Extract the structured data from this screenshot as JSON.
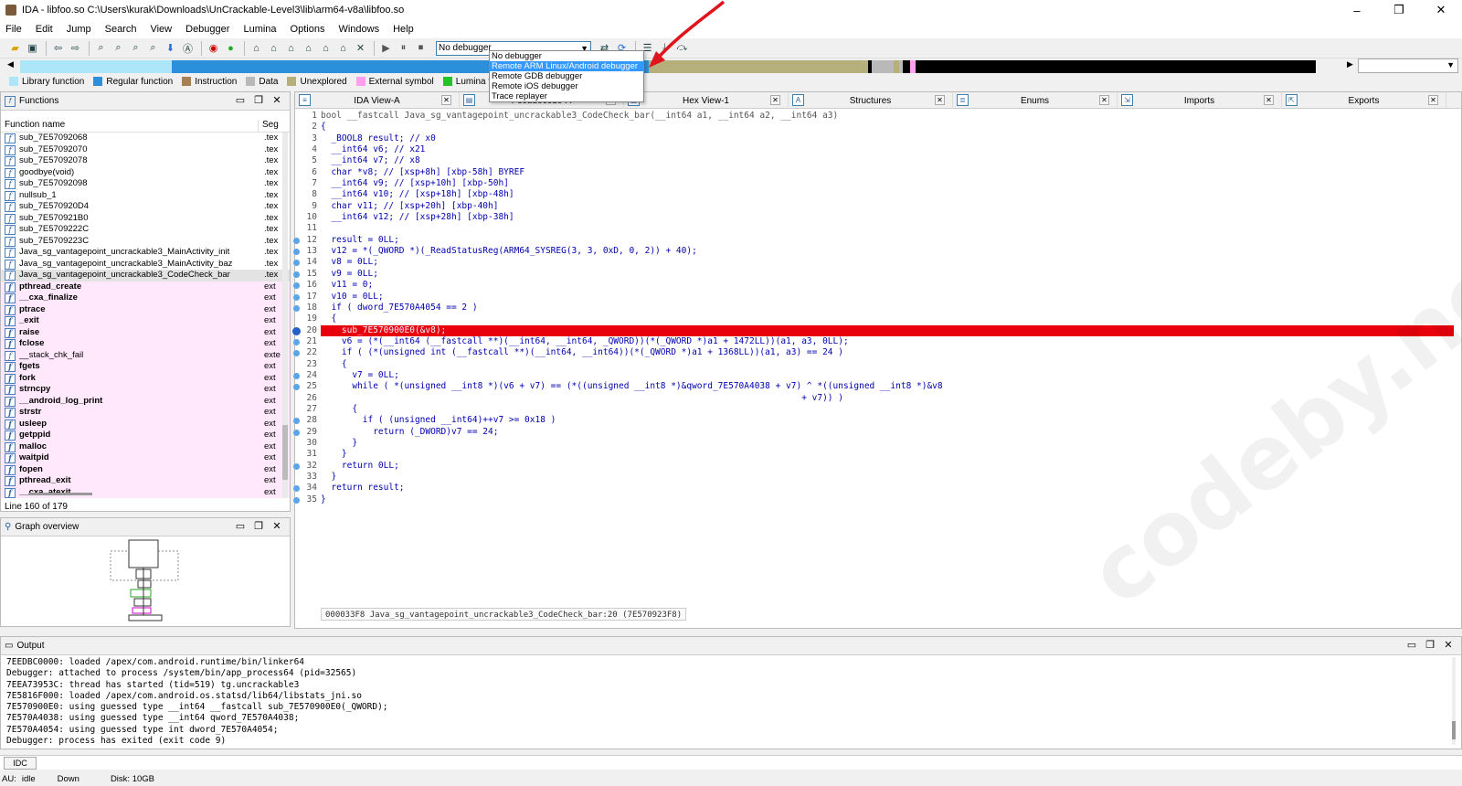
{
  "window": {
    "title": "IDA - libfoo.so C:\\Users\\kurak\\Downloads\\UnCrackable-Level3\\lib\\arm64-v8a\\libfoo.so",
    "controls": [
      "–",
      "❐",
      "✕"
    ]
  },
  "menu": [
    "File",
    "Edit",
    "Jump",
    "Search",
    "View",
    "Debugger",
    "Lumina",
    "Options",
    "Windows",
    "Help"
  ],
  "debugger": {
    "selected": "No debugger",
    "options": [
      "No debugger",
      "Remote ARM Linux/Android debugger",
      "Remote GDB debugger",
      "Remote iOS debugger",
      "Trace replayer"
    ],
    "highlighted_index": 1
  },
  "legend": [
    {
      "label": "Library function",
      "color": "#aee6f9"
    },
    {
      "label": "Regular function",
      "color": "#2b8fdc"
    },
    {
      "label": "Instruction",
      "color": "#a87e54"
    },
    {
      "label": "Data",
      "color": "#b9b9b9"
    },
    {
      "label": "Unexplored",
      "color": "#b5b07b"
    },
    {
      "label": "External symbol",
      "color": "#ff9fee"
    },
    {
      "label": "Lumina function",
      "color": "#22c22b"
    }
  ],
  "functions_panel": {
    "title": "Functions",
    "col_name": "Function name",
    "col_seg": "Seg",
    "rows": [
      {
        "name": "sub_7E57092068",
        "seg": ".tex",
        "kind": "normal"
      },
      {
        "name": "sub_7E57092070",
        "seg": ".tex",
        "kind": "normal"
      },
      {
        "name": "sub_7E57092078",
        "seg": ".tex",
        "kind": "normal"
      },
      {
        "name": "goodbye(void)",
        "seg": ".tex",
        "kind": "normal"
      },
      {
        "name": "sub_7E57092098",
        "seg": ".tex",
        "kind": "normal"
      },
      {
        "name": "nullsub_1",
        "seg": ".tex",
        "kind": "normal"
      },
      {
        "name": "sub_7E570920D4",
        "seg": ".tex",
        "kind": "normal"
      },
      {
        "name": "sub_7E570921B0",
        "seg": ".tex",
        "kind": "normal"
      },
      {
        "name": "sub_7E5709222C",
        "seg": ".tex",
        "kind": "normal"
      },
      {
        "name": "sub_7E5709223C",
        "seg": ".tex",
        "kind": "normal"
      },
      {
        "name": "Java_sg_vantagepoint_uncrackable3_MainActivity_init",
        "seg": ".tex",
        "kind": "normal"
      },
      {
        "name": "Java_sg_vantagepoint_uncrackable3_MainActivity_baz",
        "seg": ".tex",
        "kind": "normal"
      },
      {
        "name": "Java_sg_vantagepoint_uncrackable3_CodeCheck_bar",
        "seg": ".tex",
        "kind": "selected"
      },
      {
        "name": "pthread_create",
        "seg": "ext",
        "kind": "import"
      },
      {
        "name": "__cxa_finalize",
        "seg": "ext",
        "kind": "import"
      },
      {
        "name": "ptrace",
        "seg": "ext",
        "kind": "import"
      },
      {
        "name": "_exit",
        "seg": "ext",
        "kind": "import"
      },
      {
        "name": "raise",
        "seg": "ext",
        "kind": "import"
      },
      {
        "name": "fclose",
        "seg": "ext",
        "kind": "import"
      },
      {
        "name": "__stack_chk_fail",
        "seg": "exte",
        "kind": "import-light"
      },
      {
        "name": "fgets",
        "seg": "ext",
        "kind": "import"
      },
      {
        "name": "fork",
        "seg": "ext",
        "kind": "import"
      },
      {
        "name": "strncpy",
        "seg": "ext",
        "kind": "import"
      },
      {
        "name": "__android_log_print",
        "seg": "ext",
        "kind": "import"
      },
      {
        "name": "strstr",
        "seg": "ext",
        "kind": "import"
      },
      {
        "name": "usleep",
        "seg": "ext",
        "kind": "import"
      },
      {
        "name": "getppid",
        "seg": "ext",
        "kind": "import"
      },
      {
        "name": "malloc",
        "seg": "ext",
        "kind": "import"
      },
      {
        "name": "waitpid",
        "seg": "ext",
        "kind": "import"
      },
      {
        "name": "fopen",
        "seg": "ext",
        "kind": "import"
      },
      {
        "name": "pthread_exit",
        "seg": "ext",
        "kind": "import"
      },
      {
        "name": "__cxa_atexit",
        "seg": "ext",
        "kind": "import"
      }
    ],
    "status": "Line 160 of 179"
  },
  "graph_panel": {
    "title": "Graph overview"
  },
  "tabs": [
    {
      "label": "IDA View-A",
      "icon": "≡"
    },
    {
      "label": "Pseudocode-A",
      "icon": "▤"
    },
    {
      "label": "Hex View-1",
      "icon": "▦"
    },
    {
      "label": "Structures",
      "icon": "A"
    },
    {
      "label": "Enums",
      "icon": "≣"
    },
    {
      "label": "Imports",
      "icon": "⇲"
    },
    {
      "label": "Exports",
      "icon": "⇱"
    }
  ],
  "code": [
    {
      "n": "1",
      "t": "bool __fastcall Java_sg_vantagepoint_uncrackable3_CodeCheck_bar(__int64 a1, __int64 a2, __int64 a3)",
      "dot": false
    },
    {
      "n": "2",
      "t": "{",
      "dot": false
    },
    {
      "n": "3",
      "t": "  _BOOL8 result; // x0",
      "dot": false
    },
    {
      "n": "4",
      "t": "  __int64 v6; // x21",
      "dot": false
    },
    {
      "n": "5",
      "t": "  __int64 v7; // x8",
      "dot": false
    },
    {
      "n": "6",
      "t": "  char *v8; // [xsp+8h] [xbp-58h] BYREF",
      "dot": false
    },
    {
      "n": "7",
      "t": "  __int64 v9; // [xsp+10h] [xbp-50h]",
      "dot": false
    },
    {
      "n": "8",
      "t": "  __int64 v10; // [xsp+18h] [xbp-48h]",
      "dot": false
    },
    {
      "n": "9",
      "t": "  char v11; // [xsp+20h] [xbp-40h]",
      "dot": false
    },
    {
      "n": "10",
      "t": "  __int64 v12; // [xsp+28h] [xbp-38h]",
      "dot": false
    },
    {
      "n": "11",
      "t": "",
      "dot": false
    },
    {
      "n": "12",
      "t": "  result = 0LL;",
      "dot": true
    },
    {
      "n": "13",
      "t": "  v12 = *(_QWORD *)(_ReadStatusReg(ARM64_SYSREG(3, 3, 0xD, 0, 2)) + 40);",
      "dot": true
    },
    {
      "n": "14",
      "t": "  v8 = 0LL;",
      "dot": true
    },
    {
      "n": "15",
      "t": "  v9 = 0LL;",
      "dot": true
    },
    {
      "n": "16",
      "t": "  v11 = 0;",
      "dot": true
    },
    {
      "n": "17",
      "t": "  v10 = 0LL;",
      "dot": true
    },
    {
      "n": "18",
      "t": "  if ( dword_7E570A4054 == 2 )",
      "dot": true
    },
    {
      "n": "19",
      "t": "  {",
      "dot": false
    },
    {
      "n": "20",
      "t": "    sub_7E570900E0(&v8);",
      "dot": true,
      "bp": true
    },
    {
      "n": "21",
      "t": "    v6 = (*(__int64 (__fastcall **)(__int64, __int64, _QWORD))(*(_QWORD *)a1 + 1472LL))(a1, a3, 0LL);",
      "dot": true
    },
    {
      "n": "22",
      "t": "    if ( (*(unsigned int (__fastcall **)(__int64, __int64))(*(_QWORD *)a1 + 1368LL))(a1, a3) == 24 )",
      "dot": true
    },
    {
      "n": "23",
      "t": "    {",
      "dot": false
    },
    {
      "n": "24",
      "t": "      v7 = 0LL;",
      "dot": true
    },
    {
      "n": "25",
      "t": "      while ( *(unsigned __int8 *)(v6 + v7) == (*((unsigned __int8 *)&qword_7E570A4038 + v7) ^ *((unsigned __int8 *)&v8",
      "dot": true
    },
    {
      "n": "26",
      "t": "                                                                                            + v7)) )",
      "dot": false
    },
    {
      "n": "27",
      "t": "      {",
      "dot": false
    },
    {
      "n": "28",
      "t": "        if ( (unsigned __int64)++v7 >= 0x18 )",
      "dot": true
    },
    {
      "n": "29",
      "t": "          return (_DWORD)v7 == 24;",
      "dot": true
    },
    {
      "n": "30",
      "t": "      }",
      "dot": false
    },
    {
      "n": "31",
      "t": "    }",
      "dot": false
    },
    {
      "n": "32",
      "t": "    return 0LL;",
      "dot": true
    },
    {
      "n": "33",
      "t": "  }",
      "dot": false
    },
    {
      "n": "34",
      "t": "  return result;",
      "dot": true
    },
    {
      "n": "35",
      "t": "}",
      "dot": true
    }
  ],
  "code_status": "000033F8 Java_sg_vantagepoint_uncrackable3_CodeCheck_bar:20 (7E570923F8)",
  "watermark": "codeby.net",
  "output": {
    "title": "Output",
    "lines": [
      "7EEDBC0000: loaded /apex/com.android.runtime/bin/linker64",
      "Debugger: attached to process /system/bin/app_process64 (pid=32565)",
      "7EEA73953C: thread has started (tid=519) tg.uncrackable3",
      "7E5816F000: loaded /apex/com.android.os.statsd/lib64/libstats_jni.so",
      "7E570900E0: using guessed type __int64 __fastcall sub_7E570900E0(_QWORD);",
      "7E570A4038: using guessed type __int64 qword_7E570A4038;",
      "7E570A4054: using guessed type int dword_7E570A4054;",
      "Debugger: process has exited (exit code 9)"
    ]
  },
  "idc_label": "IDC",
  "status": {
    "au": "AU:",
    "state": "idle",
    "dir": "Down",
    "disk": "Disk: 10GB"
  }
}
